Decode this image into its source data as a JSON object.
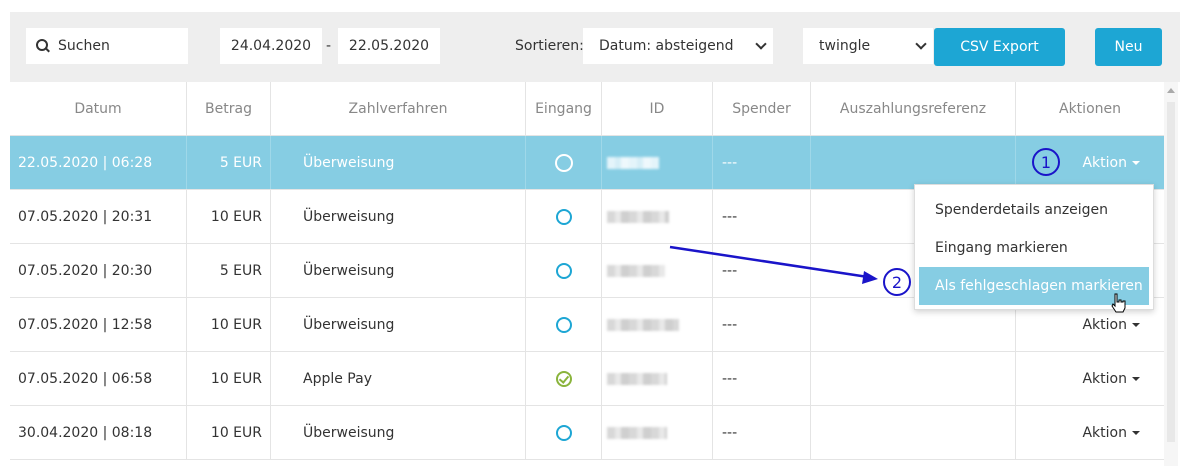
{
  "toolbar": {
    "search_placeholder": "Suchen",
    "date_from": "24.04.2020",
    "date_separator": "-",
    "date_to": "22.05.2020",
    "sort_label": "Sortieren:",
    "sort_value": "Datum: absteigend",
    "source_value": "twingle",
    "csv_label": "CSV Export",
    "new_label": "Neu",
    "accent_color": "#1da6d4"
  },
  "table": {
    "headers": [
      "Datum",
      "Betrag",
      "Zahlverfahren",
      "Eingang",
      "ID",
      "Spender",
      "Auszahlungsreferenz",
      "Aktionen"
    ],
    "rows": [
      {
        "date": "22.05.2020 | 06:28",
        "amount": "5 EUR",
        "method": "Überweisung",
        "status": "open",
        "donor": "---",
        "action": "Aktion"
      },
      {
        "date": "07.05.2020 | 20:31",
        "amount": "10 EUR",
        "method": "Überweisung",
        "status": "open",
        "donor": "---",
        "action": "Aktion"
      },
      {
        "date": "07.05.2020 | 20:30",
        "amount": "5 EUR",
        "method": "Überweisung",
        "status": "open",
        "donor": "---",
        "action": "Aktion"
      },
      {
        "date": "07.05.2020 | 12:58",
        "amount": "10 EUR",
        "method": "Überweisung",
        "status": "open",
        "donor": "---",
        "action": "Aktion"
      },
      {
        "date": "07.05.2020 | 06:58",
        "amount": "10 EUR",
        "method": "Apple Pay",
        "status": "received",
        "donor": "---",
        "action": "Aktion"
      },
      {
        "date": "30.04.2020 | 08:18",
        "amount": "10 EUR",
        "method": "Überweisung",
        "status": "open",
        "donor": "---",
        "action": "Aktion"
      }
    ],
    "selected_row_color": "#86cde3"
  },
  "dropdown_menu": {
    "items": [
      "Spenderdetails anzeigen",
      "Eingang markieren",
      "Als fehlgeschlagen markieren"
    ],
    "active_index": 2
  },
  "annotations": {
    "badge_1": "1",
    "badge_2": "2",
    "annotation_color": "#1a14c9"
  }
}
